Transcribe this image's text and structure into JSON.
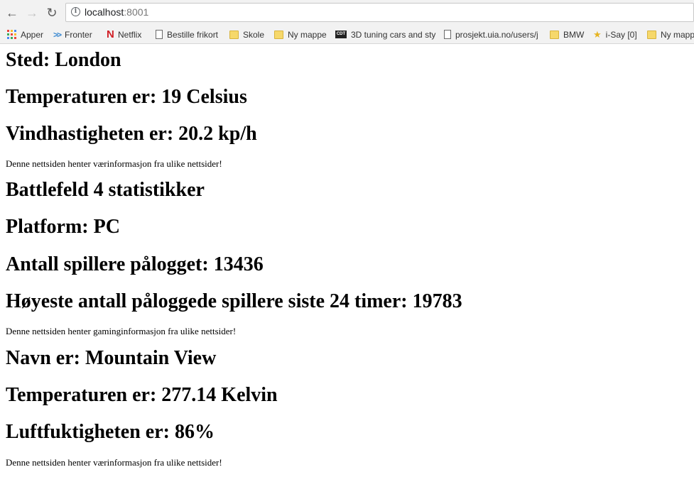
{
  "browser": {
    "url_host": "localhost",
    "url_port": ":8001",
    "bookmarks": [
      {
        "label": "Apper",
        "icon": "apps-grid-icon"
      },
      {
        "label": "Fronter",
        "icon": "fronter-icon"
      },
      {
        "label": "Netflix",
        "icon": "netflix-icon"
      },
      {
        "label": "Bestille frikort",
        "icon": "page-icon"
      },
      {
        "label": "Skole",
        "icon": "folder-icon"
      },
      {
        "label": "Ny mappe",
        "icon": "folder-icon"
      },
      {
        "label": "3D tuning cars and sty",
        "icon": "3dtuning-icon"
      },
      {
        "label": "prosjekt.uia.no/users/j",
        "icon": "page-icon"
      },
      {
        "label": "BMW",
        "icon": "folder-icon"
      },
      {
        "label": "i-Say [0]",
        "icon": "star-icon"
      },
      {
        "label": "Ny mapp",
        "icon": "folder-icon"
      }
    ]
  },
  "weather1": {
    "place": "Sted: London",
    "temperature": "Temperaturen er: 19 Celsius",
    "wind": "Vindhastigheten er: 20.2 kp/h",
    "note": "Denne nettsiden henter værinformasjon fra ulike nettsider!"
  },
  "gaming": {
    "title": "Battlefeld 4 statistikker",
    "platform": "Platform: PC",
    "online": "Antall spillere pålogget: 13436",
    "peak": "Høyeste antall påloggede spillere siste 24 timer: 19783",
    "note": "Denne nettsiden henter gaminginformasjon fra ulike nettsider!"
  },
  "weather2": {
    "name": "Navn er: Mountain View",
    "temperature": "Temperaturen er: 277.14 Kelvin",
    "humidity": "Luftfuktigheten er: 86%",
    "note": "Denne nettsiden henter værinformasjon fra ulike nettsider!"
  }
}
